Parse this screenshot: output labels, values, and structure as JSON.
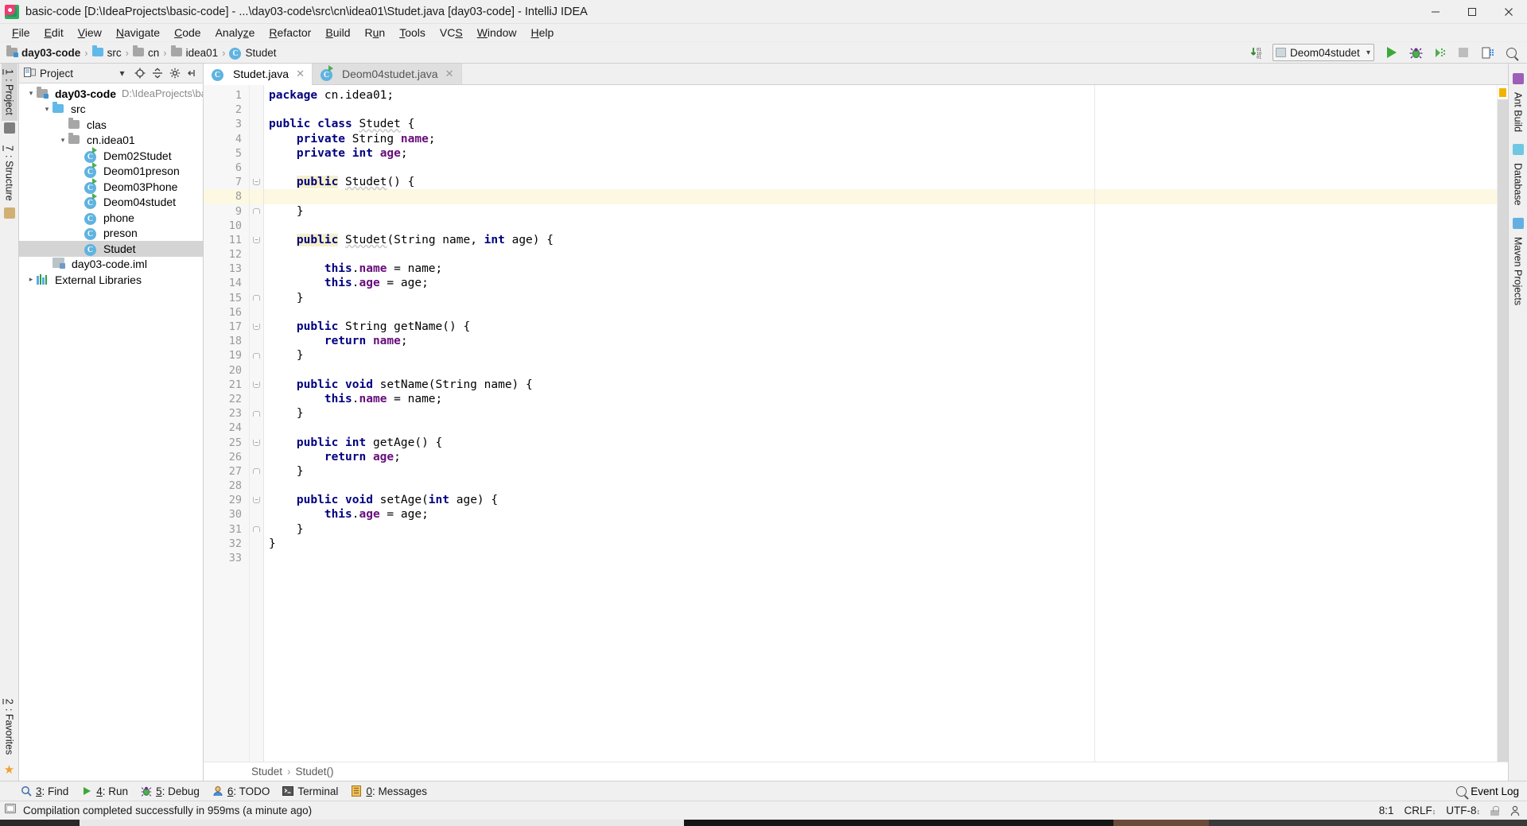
{
  "window": {
    "title": "basic-code [D:\\IdeaProjects\\basic-code] - ...\\day03-code\\src\\cn\\idea01\\Studet.java [day03-code] - IntelliJ IDEA",
    "minimize": "–",
    "maximize": "☐",
    "close": "✕"
  },
  "menu": {
    "items": [
      {
        "label": "File",
        "accel": "F"
      },
      {
        "label": "Edit",
        "accel": "E"
      },
      {
        "label": "View",
        "accel": "V"
      },
      {
        "label": "Navigate",
        "accel": "N"
      },
      {
        "label": "Code",
        "accel": "C"
      },
      {
        "label": "Analyze",
        "accel": "z"
      },
      {
        "label": "Refactor",
        "accel": "R"
      },
      {
        "label": "Build",
        "accel": "B"
      },
      {
        "label": "Run",
        "accel": "u"
      },
      {
        "label": "Tools",
        "accel": "T"
      },
      {
        "label": "VCS",
        "accel": "S"
      },
      {
        "label": "Window",
        "accel": "W"
      },
      {
        "label": "Help",
        "accel": "H"
      }
    ]
  },
  "breadcrumb": {
    "items": [
      "day03-code",
      "src",
      "cn",
      "idea01",
      "Studet"
    ],
    "separator": "›"
  },
  "toolbar": {
    "run_config": "Deom04studet",
    "chevron": "▾",
    "icons": {
      "compile": "compile-icon",
      "run": "run-icon",
      "debug": "debug-icon",
      "coverage": "run-with-coverage-icon",
      "stop": "stop-icon",
      "layout": "layout-icon",
      "search": "search-icon"
    }
  },
  "left_rail": {
    "tabs": [
      {
        "label": "1: Project",
        "accel": "1",
        "active": true
      },
      {
        "label": "7: Structure",
        "accel": "7",
        "active": false
      }
    ],
    "bottom": {
      "label": "2: Favorites",
      "accel": "2"
    }
  },
  "right_rail": {
    "tabs": [
      "Ant Build",
      "Database",
      "Maven Projects"
    ]
  },
  "project_panel": {
    "title": "Project",
    "tools": {
      "dropdown": "▾",
      "locate": "locate-icon",
      "collapse": "collapse-all-icon",
      "settings": "gear-icon",
      "hide": "hide-icon"
    },
    "tree": [
      {
        "label": "day03-code",
        "path": "D:\\IdeaProjects\\ba",
        "indent": 0,
        "arrow": "∨",
        "icon": "module",
        "bold": true,
        "selected": false
      },
      {
        "label": "src",
        "path": "",
        "indent": 1,
        "arrow": "∨",
        "icon": "folder-blue",
        "bold": false,
        "selected": false
      },
      {
        "label": "clas",
        "path": "",
        "indent": 2,
        "arrow": "",
        "icon": "folder-gray",
        "bold": false,
        "selected": false
      },
      {
        "label": "cn.idea01",
        "path": "",
        "indent": 2,
        "arrow": "∨",
        "icon": "folder-gray",
        "bold": false,
        "selected": false
      },
      {
        "label": "Dem02Studet",
        "path": "",
        "indent": 3,
        "arrow": "",
        "icon": "class-run",
        "bold": false,
        "selected": false
      },
      {
        "label": "Deom01preson",
        "path": "",
        "indent": 3,
        "arrow": "",
        "icon": "class-run",
        "bold": false,
        "selected": false
      },
      {
        "label": "Deom03Phone",
        "path": "",
        "indent": 3,
        "arrow": "",
        "icon": "class-run",
        "bold": false,
        "selected": false
      },
      {
        "label": "Deom04studet",
        "path": "",
        "indent": 3,
        "arrow": "",
        "icon": "class-run",
        "bold": false,
        "selected": false
      },
      {
        "label": "phone",
        "path": "",
        "indent": 3,
        "arrow": "",
        "icon": "class",
        "bold": false,
        "selected": false
      },
      {
        "label": "preson",
        "path": "",
        "indent": 3,
        "arrow": "",
        "icon": "class",
        "bold": false,
        "selected": false
      },
      {
        "label": "Studet",
        "path": "",
        "indent": 3,
        "arrow": "",
        "icon": "class",
        "bold": false,
        "selected": true
      },
      {
        "label": "day03-code.iml",
        "path": "",
        "indent": 1,
        "arrow": "",
        "icon": "iml",
        "bold": false,
        "selected": false
      },
      {
        "label": "External Libraries",
        "path": "",
        "indent": 0,
        "arrow": "›",
        "icon": "library",
        "bold": false,
        "selected": false
      }
    ]
  },
  "editor": {
    "tabs": [
      {
        "label": "Studet.java",
        "active": true,
        "close": "✕",
        "icon": "java-class-icon"
      },
      {
        "label": "Deom04studet.java",
        "active": false,
        "close": "✕",
        "icon": "java-class-run-icon"
      }
    ],
    "breadcrumb": {
      "items": [
        "Studet",
        "Studet()"
      ],
      "separator": "›"
    },
    "total_lines": 33,
    "caret_line": 8,
    "lines": [
      {
        "n": 1,
        "fold": "",
        "tokens": [
          {
            "t": "package ",
            "c": "kw"
          },
          {
            "t": "cn.idea01;",
            "c": "plain"
          }
        ]
      },
      {
        "n": 2,
        "fold": "",
        "tokens": []
      },
      {
        "n": 3,
        "fold": "",
        "tokens": [
          {
            "t": "public class ",
            "c": "kw"
          },
          {
            "t": "Studet",
            "c": "err"
          },
          {
            "t": " {",
            "c": "plain"
          }
        ]
      },
      {
        "n": 4,
        "fold": "",
        "tokens": [
          {
            "t": "    private ",
            "c": "kw"
          },
          {
            "t": "String ",
            "c": "plain"
          },
          {
            "t": "name",
            "c": "fld"
          },
          {
            "t": ";",
            "c": "plain"
          }
        ]
      },
      {
        "n": 5,
        "fold": "",
        "tokens": [
          {
            "t": "    private int ",
            "c": "kw"
          },
          {
            "t": "age",
            "c": "fld"
          },
          {
            "t": ";",
            "c": "plain"
          }
        ]
      },
      {
        "n": 6,
        "fold": "",
        "tokens": []
      },
      {
        "n": 7,
        "fold": "open",
        "tokens": [
          {
            "t": "    ",
            "c": "plain"
          },
          {
            "t": "public",
            "c": "kwhl"
          },
          {
            "t": " ",
            "c": "plain"
          },
          {
            "t": "Studet",
            "c": "err"
          },
          {
            "t": "() {",
            "c": "plain"
          }
        ]
      },
      {
        "n": 8,
        "fold": "",
        "tokens": []
      },
      {
        "n": 9,
        "fold": "close",
        "tokens": [
          {
            "t": "    }",
            "c": "plain"
          }
        ]
      },
      {
        "n": 10,
        "fold": "",
        "tokens": []
      },
      {
        "n": 11,
        "fold": "open",
        "tokens": [
          {
            "t": "    ",
            "c": "plain"
          },
          {
            "t": "public",
            "c": "kwhl"
          },
          {
            "t": " ",
            "c": "plain"
          },
          {
            "t": "Studet",
            "c": "err"
          },
          {
            "t": "(String name, ",
            "c": "plain"
          },
          {
            "t": "int",
            "c": "kw"
          },
          {
            "t": " age) {",
            "c": "plain"
          }
        ]
      },
      {
        "n": 12,
        "fold": "",
        "tokens": []
      },
      {
        "n": 13,
        "fold": "",
        "tokens": [
          {
            "t": "        ",
            "c": "plain"
          },
          {
            "t": "this",
            "c": "kw"
          },
          {
            "t": ".",
            "c": "plain"
          },
          {
            "t": "name",
            "c": "fld"
          },
          {
            "t": " = name;",
            "c": "plain"
          }
        ]
      },
      {
        "n": 14,
        "fold": "",
        "tokens": [
          {
            "t": "        ",
            "c": "plain"
          },
          {
            "t": "this",
            "c": "kw"
          },
          {
            "t": ".",
            "c": "plain"
          },
          {
            "t": "age",
            "c": "fld"
          },
          {
            "t": " = age;",
            "c": "plain"
          }
        ]
      },
      {
        "n": 15,
        "fold": "close",
        "tokens": [
          {
            "t": "    }",
            "c": "plain"
          }
        ]
      },
      {
        "n": 16,
        "fold": "",
        "tokens": []
      },
      {
        "n": 17,
        "fold": "open",
        "tokens": [
          {
            "t": "    ",
            "c": "plain"
          },
          {
            "t": "public",
            "c": "kw"
          },
          {
            "t": " String getName() {",
            "c": "plain"
          }
        ]
      },
      {
        "n": 18,
        "fold": "",
        "tokens": [
          {
            "t": "        ",
            "c": "plain"
          },
          {
            "t": "return ",
            "c": "kw"
          },
          {
            "t": "name",
            "c": "fld"
          },
          {
            "t": ";",
            "c": "plain"
          }
        ]
      },
      {
        "n": 19,
        "fold": "close",
        "tokens": [
          {
            "t": "    }",
            "c": "plain"
          }
        ]
      },
      {
        "n": 20,
        "fold": "",
        "tokens": []
      },
      {
        "n": 21,
        "fold": "open",
        "tokens": [
          {
            "t": "    ",
            "c": "plain"
          },
          {
            "t": "public void",
            "c": "kw"
          },
          {
            "t": " setName(String name) {",
            "c": "plain"
          }
        ]
      },
      {
        "n": 22,
        "fold": "",
        "tokens": [
          {
            "t": "        ",
            "c": "plain"
          },
          {
            "t": "this",
            "c": "kw"
          },
          {
            "t": ".",
            "c": "plain"
          },
          {
            "t": "name",
            "c": "fld"
          },
          {
            "t": " = name;",
            "c": "plain"
          }
        ]
      },
      {
        "n": 23,
        "fold": "close",
        "tokens": [
          {
            "t": "    }",
            "c": "plain"
          }
        ]
      },
      {
        "n": 24,
        "fold": "",
        "tokens": []
      },
      {
        "n": 25,
        "fold": "open",
        "tokens": [
          {
            "t": "    ",
            "c": "plain"
          },
          {
            "t": "public int",
            "c": "kw"
          },
          {
            "t": " getAge() {",
            "c": "plain"
          }
        ]
      },
      {
        "n": 26,
        "fold": "",
        "tokens": [
          {
            "t": "        ",
            "c": "plain"
          },
          {
            "t": "return ",
            "c": "kw"
          },
          {
            "t": "age",
            "c": "fld"
          },
          {
            "t": ";",
            "c": "plain"
          }
        ]
      },
      {
        "n": 27,
        "fold": "close",
        "tokens": [
          {
            "t": "    }",
            "c": "plain"
          }
        ]
      },
      {
        "n": 28,
        "fold": "",
        "tokens": []
      },
      {
        "n": 29,
        "fold": "open",
        "tokens": [
          {
            "t": "    ",
            "c": "plain"
          },
          {
            "t": "public void",
            "c": "kw"
          },
          {
            "t": " setAge(",
            "c": "plain"
          },
          {
            "t": "int",
            "c": "kw"
          },
          {
            "t": " age) {",
            "c": "plain"
          }
        ]
      },
      {
        "n": 30,
        "fold": "",
        "tokens": [
          {
            "t": "        ",
            "c": "plain"
          },
          {
            "t": "this",
            "c": "kw"
          },
          {
            "t": ".",
            "c": "plain"
          },
          {
            "t": "age",
            "c": "fld"
          },
          {
            "t": " = age;",
            "c": "plain"
          }
        ]
      },
      {
        "n": 31,
        "fold": "close",
        "tokens": [
          {
            "t": "    }",
            "c": "plain"
          }
        ]
      },
      {
        "n": 32,
        "fold": "",
        "tokens": [
          {
            "t": "}",
            "c": "plain"
          }
        ]
      },
      {
        "n": 33,
        "fold": "",
        "tokens": []
      }
    ]
  },
  "bottom_tools": {
    "items": [
      {
        "label": "3: Find",
        "accel": "3",
        "icon": "search-icon"
      },
      {
        "label": "4: Run",
        "accel": "4",
        "icon": "run-icon"
      },
      {
        "label": "5: Debug",
        "accel": "5",
        "icon": "debug-icon"
      },
      {
        "label": "6: TODO",
        "accel": "6",
        "icon": "todo-icon"
      },
      {
        "label": "Terminal",
        "accel": "",
        "icon": "terminal-icon"
      },
      {
        "label": "0: Messages",
        "accel": "0",
        "icon": "messages-icon"
      }
    ],
    "event_log": "Event Log"
  },
  "statusbar": {
    "message": "Compilation completed successfully in 959ms (a minute ago)",
    "position": "8:1",
    "line_separator": "CRLF",
    "encoding": "UTF-8",
    "chevron": "↕"
  },
  "colors": {
    "keyword": "#000080",
    "field": "#660e7a",
    "caret_line": "#fcf8e2",
    "selection": "#d4d4d4",
    "accent_green": "#3aa93a",
    "marker_yellow": "#d9a400"
  }
}
